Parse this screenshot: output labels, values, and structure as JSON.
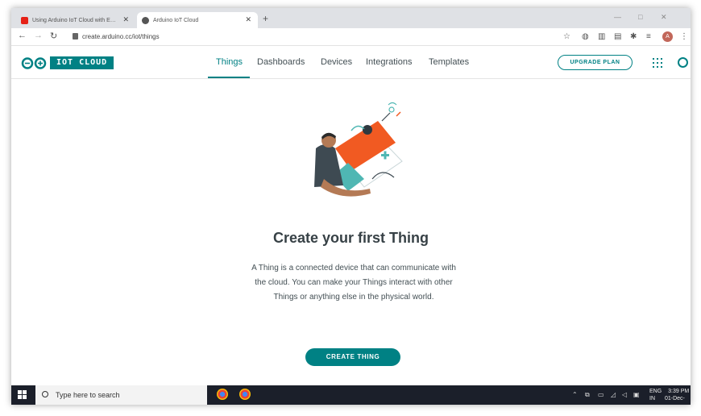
{
  "browser": {
    "tabs": [
      {
        "label": "Using Arduino IoT Cloud with E…"
      },
      {
        "label": "Arduino IoT Cloud"
      }
    ],
    "url": "create.arduino.cc/iot/things",
    "profile_initial": "A"
  },
  "header": {
    "logo_text": "IOT CLOUD",
    "nav": [
      {
        "label": "Things",
        "active": true
      },
      {
        "label": "Dashboards"
      },
      {
        "label": "Devices"
      },
      {
        "label": "Integrations"
      },
      {
        "label": "Templates"
      }
    ],
    "upgrade_label": "UPGRADE PLAN"
  },
  "main": {
    "title": "Create your first Thing",
    "description": "A Thing is a connected device that can communicate with the cloud. You can make your Things interact with other Things or anything else in the physical world.",
    "create_button_label": "CREATE THING"
  },
  "taskbar": {
    "search_placeholder": "Type here to search",
    "language": "ENG",
    "region": "IN",
    "time": "3:39 PM",
    "date": "01-Dec-"
  },
  "colors": {
    "accent": "#008184",
    "orange": "#f15a22"
  }
}
